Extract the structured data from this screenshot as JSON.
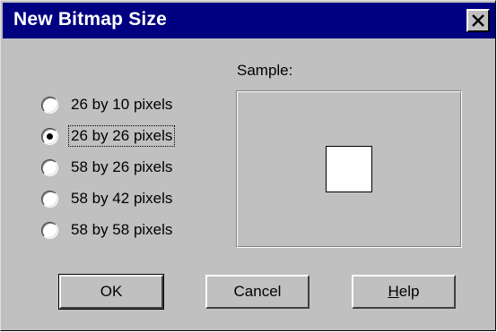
{
  "window": {
    "title": "New Bitmap Size",
    "close_glyph": "✕"
  },
  "sample": {
    "label": "Sample:"
  },
  "options": [
    {
      "label": "26 by 10 pixels",
      "checked": false
    },
    {
      "label": "26 by 26 pixels",
      "checked": true
    },
    {
      "label": "58 by 26 pixels",
      "checked": false
    },
    {
      "label": "58 by 42 pixels",
      "checked": false
    },
    {
      "label": "58 by 58 pixels",
      "checked": false
    }
  ],
  "buttons": {
    "ok": "OK",
    "cancel": "Cancel",
    "help_accel": "H",
    "help_rest": "elp"
  },
  "colors": {
    "titlebar": "#000080",
    "face": "#c0c0c0"
  }
}
